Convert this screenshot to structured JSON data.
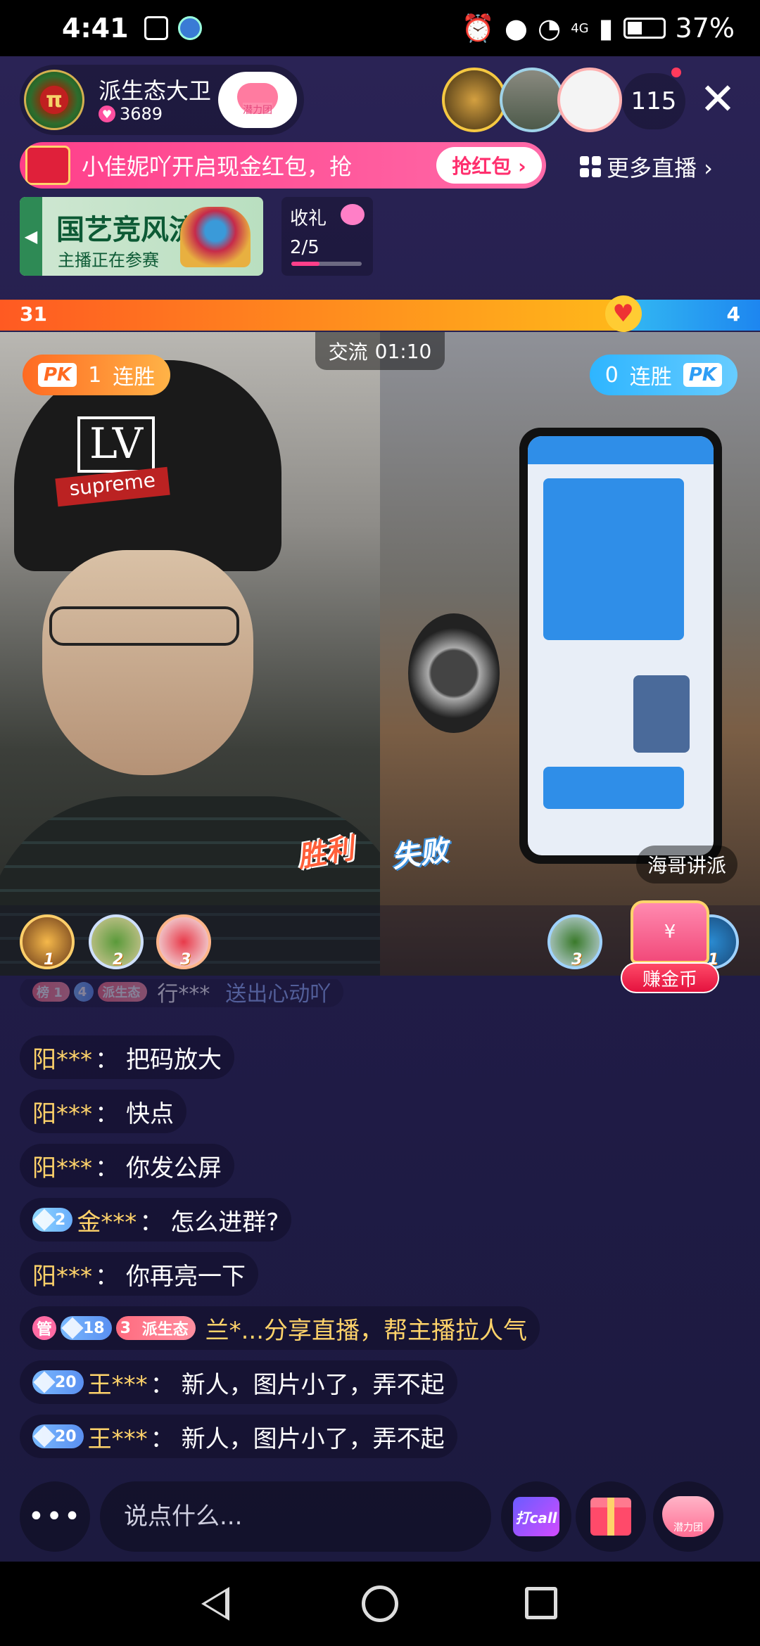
{
  "status_bar": {
    "time": "4:41",
    "battery": "37%",
    "network": "4G",
    "battery_level": 0.37
  },
  "header": {
    "host_name": "派生态大卫",
    "host_likes": "3689",
    "host_avatar_text": "π",
    "fan_club_label": "潜力团",
    "viewer_count": "115"
  },
  "red_packet": {
    "text": "小佳妮吖开启现金红包，抢",
    "button": "抢红包 ›"
  },
  "more_live": "更多直播 ›",
  "event_banner": {
    "title": "国艺竞风流",
    "subtitle": "主播正在参赛"
  },
  "gift_task": {
    "label": "收礼",
    "progress_text": "2/5",
    "progress": 0.4
  },
  "pk": {
    "left_score": "31",
    "right_score": "4",
    "left_share": 0.82,
    "timer_label": "交流",
    "timer_value": "01:10",
    "left_streak_count": "1",
    "right_streak_count": "0",
    "streak_label": "连胜",
    "pk_tag": "PK",
    "win_label": "胜利",
    "lose_label": "失败",
    "right_streamer": "海哥讲派",
    "earn_coins": "赚金币",
    "chest_symbol": "¥"
  },
  "ranks": {
    "left": [
      "1",
      "2",
      "3"
    ],
    "right": [
      "3",
      "1"
    ]
  },
  "chat": {
    "faded_line": {
      "badges": [
        "榜 1",
        "4",
        "派生态"
      ],
      "user": "行***",
      "text": "送出心动吖"
    },
    "messages": [
      {
        "user": "阳***",
        "text": "把码放大"
      },
      {
        "user": "阳***",
        "text": "快点"
      },
      {
        "user": "阳***",
        "text": "你发公屏"
      },
      {
        "badge": "2",
        "user": "金***",
        "text": "怎么进群?"
      },
      {
        "user": "阳***",
        "text": "你再亮一下"
      },
      {
        "badges": [
          "管",
          "18",
          "3",
          "派生态"
        ],
        "text": "兰*...分享直播，帮主播拉人气"
      },
      {
        "badge": "20",
        "user": "王***",
        "text": "新人，图片小了，弄不起"
      },
      {
        "badge": "20",
        "user": "王***",
        "text": "新人，图片小了，弄不起"
      }
    ],
    "colon": "："
  },
  "toolbar": {
    "more": "•••",
    "input_placeholder": "说点什么...",
    "call_label": "打call",
    "fans_label": "潜力团"
  },
  "colors": {
    "accent_pink": "#ff3f8a",
    "pk_orange": "#ff5a22",
    "pk_blue": "#1d86f0",
    "username_gold": "#ffd36a"
  }
}
